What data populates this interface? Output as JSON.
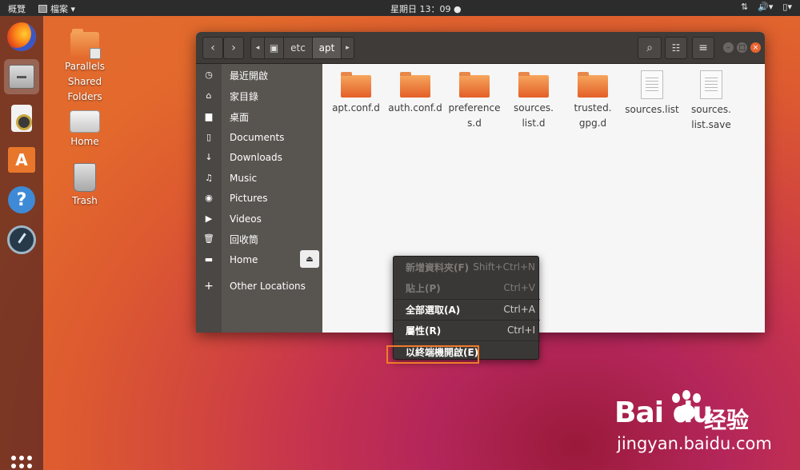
{
  "topbar": {
    "activities": "概覽",
    "app_menu": "檔案 ▾",
    "clock": "星期日 13：09 ●",
    "tray": [
      "network-icon",
      "volume-icon ▾",
      "battery-icon ▾"
    ]
  },
  "dock": {
    "items": [
      "firefox-icon",
      "files-icon",
      "rhythmbox-icon",
      "ubuntu-software-icon",
      "help-icon",
      "disk-icon"
    ],
    "active": "files-icon"
  },
  "desktop": {
    "icons": [
      {
        "label": "Parallels Shared Folders"
      },
      {
        "label": "Home"
      },
      {
        "label": "Trash"
      }
    ]
  },
  "window": {
    "path": [
      "etc",
      "apt"
    ],
    "current": "apt",
    "sidebar": [
      {
        "icon": "recent-icon",
        "label": "最近開啟"
      },
      {
        "icon": "home-icon",
        "label": "家目錄"
      },
      {
        "icon": "desktop-icon",
        "label": "桌面"
      },
      {
        "icon": "documents-icon",
        "label": "Documents"
      },
      {
        "icon": "downloads-icon",
        "label": "Downloads"
      },
      {
        "icon": "music-icon",
        "label": "Music"
      },
      {
        "icon": "pictures-icon",
        "label": "Pictures"
      },
      {
        "icon": "videos-icon",
        "label": "Videos"
      },
      {
        "icon": "trash-icon",
        "label": "回收筒"
      },
      {
        "icon": "drive-icon",
        "label": "Home"
      },
      {
        "icon": "plus-icon",
        "label": "Other Locations"
      }
    ],
    "files": [
      {
        "type": "folder",
        "line1": "apt.conf.d",
        "line2": ""
      },
      {
        "type": "folder",
        "line1": "auth.conf.d",
        "line2": ""
      },
      {
        "type": "folder",
        "line1": "preference",
        "line2": "s.d"
      },
      {
        "type": "folder",
        "line1": "sources.",
        "line2": "list.d"
      },
      {
        "type": "folder",
        "line1": "trusted.",
        "line2": "gpg.d"
      },
      {
        "type": "file",
        "line1": "sources.list",
        "line2": ""
      },
      {
        "type": "file",
        "line1": "sources.",
        "line2": "list.save"
      }
    ]
  },
  "context_menu": {
    "items": [
      {
        "label": "新增資料夾(F)",
        "shortcut": "Shift+Ctrl+N",
        "disabled": true
      },
      {
        "label": "貼上(P)",
        "shortcut": "Ctrl+V",
        "disabled": true
      },
      {
        "label": "全部選取(A)",
        "shortcut": "Ctrl+A",
        "disabled": false
      },
      {
        "label": "屬性(R)",
        "shortcut": "Ctrl+I",
        "disabled": false
      },
      {
        "label": "以終端機開啟(E)",
        "shortcut": "",
        "disabled": false
      }
    ]
  },
  "watermark": {
    "logo": "Bai  du",
    "cn": "经验",
    "url": "jingyan.baidu.com"
  },
  "colors": {
    "accent": "#e9642f",
    "highlight_box": "#f07b2a",
    "sidebar_bg": "#585450",
    "headerbar_bg": "#3e3b39"
  }
}
